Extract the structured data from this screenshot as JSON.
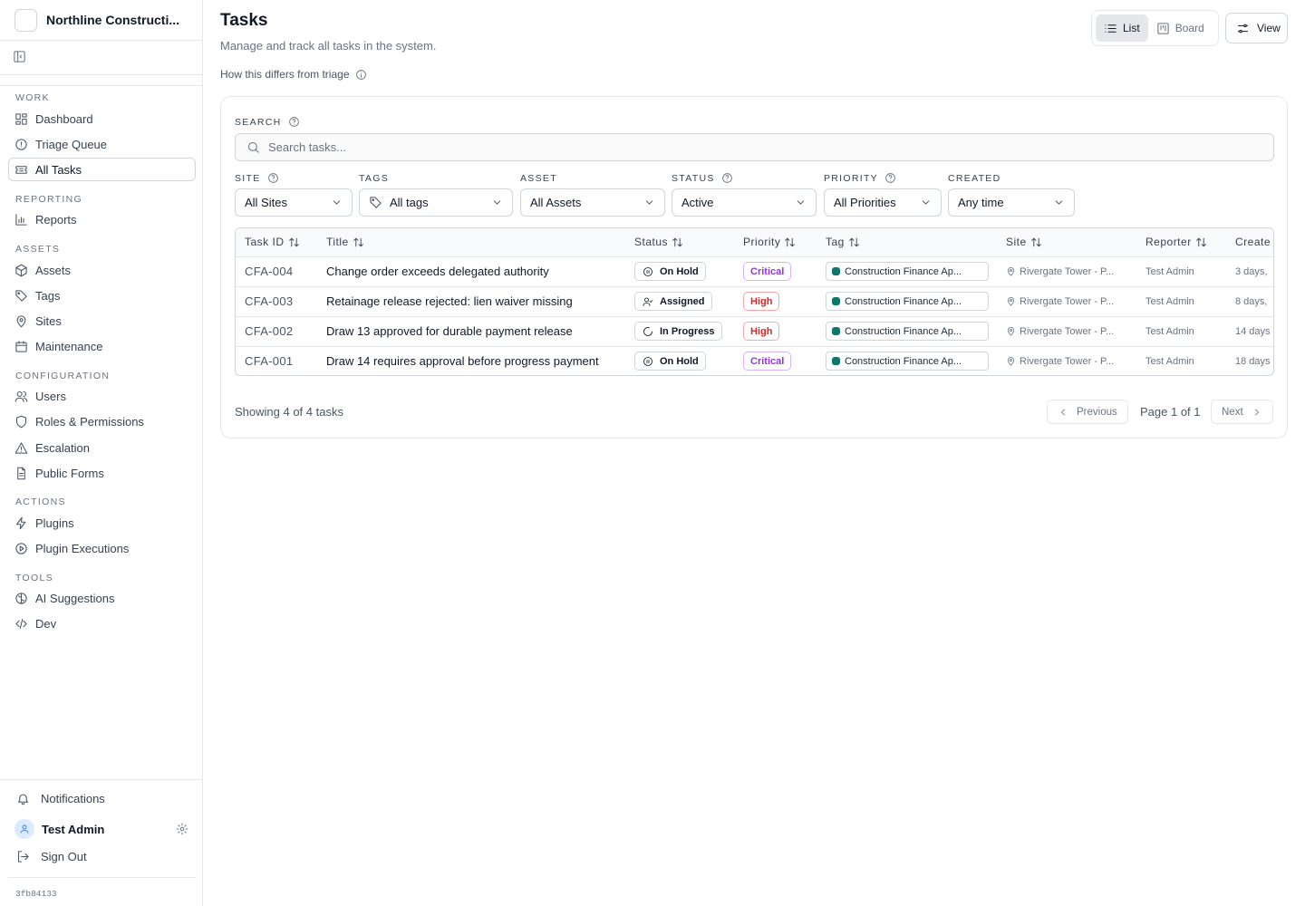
{
  "sidebar": {
    "org_name": "Northline Constructi...",
    "sections": {
      "work": "WORK",
      "reporting": "REPORTING",
      "assets": "ASSETS",
      "configuration": "CONFIGURATION",
      "actions": "ACTIONS",
      "tools": "TOOLS"
    },
    "items": {
      "dashboard": "Dashboard",
      "triage": "Triage Queue",
      "all_tasks": "All Tasks",
      "reports": "Reports",
      "assets": "Assets",
      "tags": "Tags",
      "sites": "Sites",
      "maintenance": "Maintenance",
      "users": "Users",
      "roles": "Roles & Permissions",
      "escalation": "Escalation",
      "public_forms": "Public Forms",
      "plugins": "Plugins",
      "plugin_executions": "Plugin Executions",
      "ai_suggestions": "AI Suggestions",
      "dev": "Dev"
    },
    "active_item": "all_tasks",
    "footer": {
      "notifications": "Notifications",
      "user_name": "Test Admin",
      "sign_out": "Sign Out",
      "version": "3fb84133"
    }
  },
  "header": {
    "title": "Tasks",
    "subtitle": "Manage and track all tasks in the system.",
    "help_link": "How this differs from triage",
    "view_toggle": {
      "list": "List",
      "board": "Board",
      "selected": "List"
    },
    "view_button": "View"
  },
  "filters": {
    "search_label": "SEARCH",
    "search_placeholder": "Search tasks...",
    "site": {
      "label": "SITE",
      "value": "All Sites"
    },
    "tags": {
      "label": "TAGS",
      "value": "All tags"
    },
    "asset": {
      "label": "ASSET",
      "value": "All Assets"
    },
    "status": {
      "label": "STATUS",
      "value": "Active"
    },
    "priority": {
      "label": "PRIORITY",
      "value": "All Priorities"
    },
    "created": {
      "label": "CREATED",
      "value": "Any time"
    }
  },
  "table": {
    "columns": {
      "task_id": "Task ID",
      "title": "Title",
      "status": "Status",
      "priority": "Priority",
      "tag": "Tag",
      "site": "Site",
      "reporter": "Reporter",
      "created": "Create"
    },
    "rows": [
      {
        "task_id": "CFA-004",
        "title": "Change order exceeds delegated authority",
        "status": "On Hold",
        "status_icon": "pause-circle-icon",
        "priority": "Critical",
        "tag": "Construction Finance Ap...",
        "site": "Rivergate Tower - P...",
        "reporter": "Test Admin",
        "created": "3 days,"
      },
      {
        "task_id": "CFA-003",
        "title": "Retainage release rejected: lien waiver missing",
        "status": "Assigned",
        "status_icon": "user-check-icon",
        "priority": "High",
        "tag": "Construction Finance Ap...",
        "site": "Rivergate Tower - P...",
        "reporter": "Test Admin",
        "created": "8 days,"
      },
      {
        "task_id": "CFA-002",
        "title": "Draw 13 approved for durable payment release",
        "status": "In Progress",
        "status_icon": "spinner-icon",
        "priority": "High",
        "tag": "Construction Finance Ap...",
        "site": "Rivergate Tower - P...",
        "reporter": "Test Admin",
        "created": "14 days"
      },
      {
        "task_id": "CFA-001",
        "title": "Draw 14 requires approval before progress payment",
        "status": "On Hold",
        "status_icon": "pause-circle-icon",
        "priority": "Critical",
        "tag": "Construction Finance Ap...",
        "site": "Rivergate Tower - P...",
        "reporter": "Test Admin",
        "created": "18 days"
      }
    ]
  },
  "colors": {
    "critical_text": "#9333ea",
    "critical_border": "#d8b4fe",
    "high_text": "#dc2626",
    "high_border": "#fca5a5",
    "tag_dot": "#0f766e"
  },
  "pagination": {
    "showing": "Showing 4 of 4 tasks",
    "previous": "Previous",
    "page_info": "Page 1 of 1",
    "next": "Next"
  }
}
